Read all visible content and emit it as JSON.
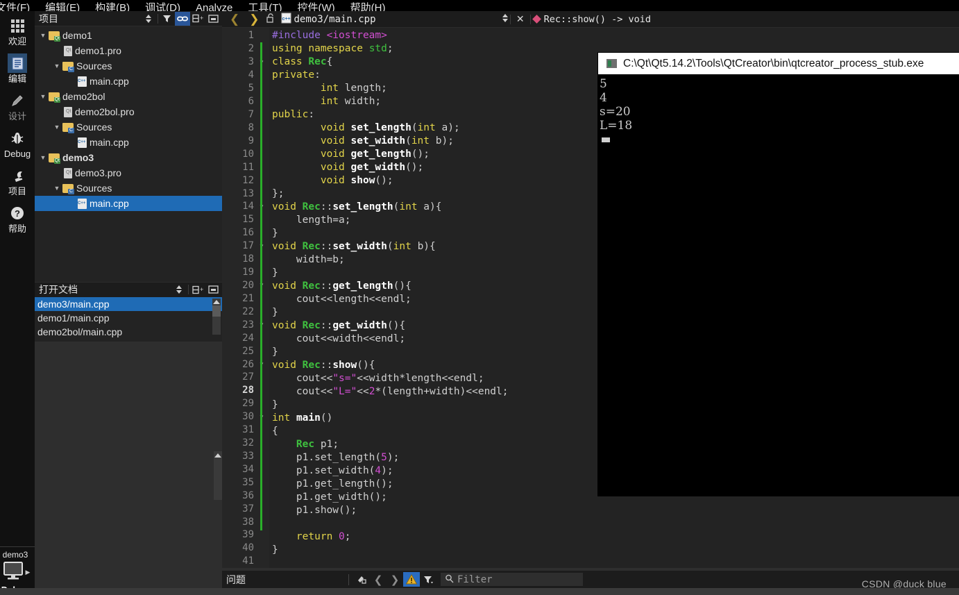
{
  "menubar": {
    "items": [
      {
        "label": "文件(F)"
      },
      {
        "label": "编辑(E)"
      },
      {
        "label": "构建(B)"
      },
      {
        "label": "调试(D)"
      },
      {
        "label": "Analyze"
      },
      {
        "label": "工具(T)"
      },
      {
        "label": "控件(W)"
      },
      {
        "label": "帮助(H)"
      }
    ]
  },
  "modebar": {
    "items": [
      {
        "label": "欢迎",
        "icon": "grid-icon"
      },
      {
        "label": "编辑",
        "icon": "document-icon"
      },
      {
        "label": "设计",
        "icon": "pencil-icon"
      },
      {
        "label": "Debug",
        "icon": "bug-icon"
      },
      {
        "label": "项目",
        "icon": "wrench-icon"
      },
      {
        "label": "帮助",
        "icon": "question-icon"
      }
    ],
    "active": "编辑",
    "run": {
      "kit_name": "demo3",
      "debug_label": "Debug",
      "monitor_icon": "monitor-icon",
      "play_icon": "play-arrow-icon"
    }
  },
  "project_panel": {
    "title": "项目",
    "toolbar": [
      {
        "name": "filter-mode-selector",
        "icon": "updown-arrows-icon"
      },
      {
        "name": "filter-tree-button",
        "icon": "funnel-icon"
      },
      {
        "name": "synchronize-with-editor-button",
        "icon": "link-icon",
        "selected": true
      },
      {
        "name": "split-button",
        "icon": "split-icon"
      },
      {
        "name": "close-sidebar-button",
        "icon": "close-panel-icon"
      }
    ],
    "tree": [
      {
        "label": "demo1",
        "depth": 0,
        "icon": "qt-project-folder-icon",
        "arrow": "expanded",
        "bold": false,
        "selected": false
      },
      {
        "label": "demo1.pro",
        "depth": 1,
        "icon": "pro-file-icon",
        "arrow": "none",
        "bold": false,
        "selected": false
      },
      {
        "label": "Sources",
        "depth": 1,
        "icon": "sources-folder-icon",
        "arrow": "expanded",
        "bold": false,
        "selected": false
      },
      {
        "label": "main.cpp",
        "depth": 2,
        "icon": "cpp-file-icon",
        "arrow": "none",
        "bold": false,
        "selected": false
      },
      {
        "label": "demo2bol",
        "depth": 0,
        "icon": "qt-project-folder-icon",
        "arrow": "expanded",
        "bold": false,
        "selected": false
      },
      {
        "label": "demo2bol.pro",
        "depth": 1,
        "icon": "pro-file-icon",
        "arrow": "none",
        "bold": false,
        "selected": false
      },
      {
        "label": "Sources",
        "depth": 1,
        "icon": "sources-folder-icon",
        "arrow": "expanded",
        "bold": false,
        "selected": false
      },
      {
        "label": "main.cpp",
        "depth": 2,
        "icon": "cpp-file-icon",
        "arrow": "none",
        "bold": false,
        "selected": false
      },
      {
        "label": "demo3",
        "depth": 0,
        "icon": "qt-project-folder-icon",
        "arrow": "expanded",
        "bold": true,
        "selected": false
      },
      {
        "label": "demo3.pro",
        "depth": 1,
        "icon": "pro-file-icon",
        "arrow": "none",
        "bold": false,
        "selected": false
      },
      {
        "label": "Sources",
        "depth": 1,
        "icon": "sources-folder-icon",
        "arrow": "expanded",
        "bold": false,
        "selected": false
      },
      {
        "label": "main.cpp",
        "depth": 2,
        "icon": "cpp-file-icon",
        "arrow": "none",
        "bold": false,
        "selected": true
      }
    ]
  },
  "open_documents": {
    "title": "打开文档",
    "toolbar": [
      {
        "name": "opendocs-sort-button",
        "icon": "updown-arrows-icon"
      },
      {
        "name": "opendocs-split-button",
        "icon": "split-icon"
      },
      {
        "name": "opendocs-close-button",
        "icon": "close-panel-icon"
      }
    ],
    "items": [
      {
        "label": "demo3/main.cpp",
        "selected": true
      },
      {
        "label": "demo1/main.cpp",
        "selected": false
      },
      {
        "label": "demo2bol/main.cpp",
        "selected": false
      }
    ]
  },
  "editor": {
    "toolbar": {
      "back_icon": "chevron-left-icon",
      "forward_icon": "chevron-right-icon",
      "lock_icon": "unlocked-padlock-icon",
      "file_icon": "cpp-file-icon",
      "file_name": "demo3/main.cpp",
      "updown_icon": "updown-arrows-icon",
      "close_icon": "close-icon",
      "symbol_icon": "method-diamond-icon",
      "symbol_name": "Rec::show() -> void"
    },
    "current_line": 28,
    "total_lines": 41,
    "lines": [
      {
        "n": 1,
        "fold": false,
        "mod": false,
        "tokens": [
          [
            "pp",
            "#include"
          ],
          [
            "n",
            " "
          ],
          [
            "inc",
            "<iostream>"
          ]
        ]
      },
      {
        "n": 2,
        "fold": false,
        "mod": true,
        "tokens": [
          [
            "k",
            "using"
          ],
          [
            "n",
            " "
          ],
          [
            "k",
            "namespace"
          ],
          [
            "n",
            " "
          ],
          [
            "gr",
            "std"
          ],
          [
            "n",
            ";"
          ]
        ]
      },
      {
        "n": 3,
        "fold": true,
        "mod": true,
        "tokens": [
          [
            "k",
            "class"
          ],
          [
            "n",
            " "
          ],
          [
            "ty",
            "Rec"
          ],
          [
            "n",
            "{"
          ]
        ]
      },
      {
        "n": 4,
        "fold": false,
        "mod": true,
        "tokens": [
          [
            "k",
            "private"
          ],
          [
            "n",
            ":"
          ]
        ]
      },
      {
        "n": 5,
        "fold": false,
        "mod": true,
        "tokens": [
          [
            "n",
            "        "
          ],
          [
            "k",
            "int"
          ],
          [
            "n",
            " length;"
          ]
        ]
      },
      {
        "n": 6,
        "fold": false,
        "mod": true,
        "tokens": [
          [
            "n",
            "        "
          ],
          [
            "k",
            "int"
          ],
          [
            "n",
            " width;"
          ]
        ]
      },
      {
        "n": 7,
        "fold": false,
        "mod": true,
        "tokens": [
          [
            "k",
            "public"
          ],
          [
            "n",
            ":"
          ]
        ]
      },
      {
        "n": 8,
        "fold": false,
        "mod": true,
        "tokens": [
          [
            "n",
            "        "
          ],
          [
            "k",
            "void"
          ],
          [
            "n",
            " "
          ],
          [
            "fn",
            "set_length"
          ],
          [
            "n",
            "("
          ],
          [
            "k",
            "int"
          ],
          [
            "n",
            " a);"
          ]
        ]
      },
      {
        "n": 9,
        "fold": false,
        "mod": true,
        "tokens": [
          [
            "n",
            "        "
          ],
          [
            "k",
            "void"
          ],
          [
            "n",
            " "
          ],
          [
            "fn",
            "set_width"
          ],
          [
            "n",
            "("
          ],
          [
            "k",
            "int"
          ],
          [
            "n",
            " b);"
          ]
        ]
      },
      {
        "n": 10,
        "fold": false,
        "mod": true,
        "tokens": [
          [
            "n",
            "        "
          ],
          [
            "k",
            "void"
          ],
          [
            "n",
            " "
          ],
          [
            "fn",
            "get_length"
          ],
          [
            "n",
            "();"
          ]
        ]
      },
      {
        "n": 11,
        "fold": false,
        "mod": true,
        "tokens": [
          [
            "n",
            "        "
          ],
          [
            "k",
            "void"
          ],
          [
            "n",
            " "
          ],
          [
            "fn",
            "get_width"
          ],
          [
            "n",
            "();"
          ]
        ]
      },
      {
        "n": 12,
        "fold": false,
        "mod": true,
        "tokens": [
          [
            "n",
            "        "
          ],
          [
            "k",
            "void"
          ],
          [
            "n",
            " "
          ],
          [
            "fn",
            "show"
          ],
          [
            "n",
            "();"
          ]
        ]
      },
      {
        "n": 13,
        "fold": false,
        "mod": true,
        "tokens": [
          [
            "n",
            "};"
          ]
        ]
      },
      {
        "n": 14,
        "fold": true,
        "mod": true,
        "tokens": [
          [
            "k",
            "void"
          ],
          [
            "n",
            " "
          ],
          [
            "ty",
            "Rec"
          ],
          [
            "n",
            "::"
          ],
          [
            "fn",
            "set_length"
          ],
          [
            "n",
            "("
          ],
          [
            "k",
            "int"
          ],
          [
            "n",
            " a){"
          ]
        ]
      },
      {
        "n": 15,
        "fold": false,
        "mod": true,
        "tokens": [
          [
            "n",
            "    length=a;"
          ]
        ]
      },
      {
        "n": 16,
        "fold": false,
        "mod": true,
        "tokens": [
          [
            "n",
            "}"
          ]
        ]
      },
      {
        "n": 17,
        "fold": true,
        "mod": true,
        "tokens": [
          [
            "k",
            "void"
          ],
          [
            "n",
            " "
          ],
          [
            "ty",
            "Rec"
          ],
          [
            "n",
            "::"
          ],
          [
            "fn",
            "set_width"
          ],
          [
            "n",
            "("
          ],
          [
            "k",
            "int"
          ],
          [
            "n",
            " b){"
          ]
        ]
      },
      {
        "n": 18,
        "fold": false,
        "mod": true,
        "tokens": [
          [
            "n",
            "    width=b;"
          ]
        ]
      },
      {
        "n": 19,
        "fold": false,
        "mod": true,
        "tokens": [
          [
            "n",
            "}"
          ]
        ]
      },
      {
        "n": 20,
        "fold": true,
        "mod": true,
        "tokens": [
          [
            "k",
            "void"
          ],
          [
            "n",
            " "
          ],
          [
            "ty",
            "Rec"
          ],
          [
            "n",
            "::"
          ],
          [
            "fn",
            "get_length"
          ],
          [
            "n",
            "(){"
          ]
        ]
      },
      {
        "n": 21,
        "fold": false,
        "mod": true,
        "tokens": [
          [
            "n",
            "    cout<<length<<endl;"
          ]
        ]
      },
      {
        "n": 22,
        "fold": false,
        "mod": true,
        "tokens": [
          [
            "n",
            "}"
          ]
        ]
      },
      {
        "n": 23,
        "fold": true,
        "mod": true,
        "tokens": [
          [
            "k",
            "void"
          ],
          [
            "n",
            " "
          ],
          [
            "ty",
            "Rec"
          ],
          [
            "n",
            "::"
          ],
          [
            "fn",
            "get_width"
          ],
          [
            "n",
            "(){"
          ]
        ]
      },
      {
        "n": 24,
        "fold": false,
        "mod": true,
        "tokens": [
          [
            "n",
            "    cout<<width<<endl;"
          ]
        ]
      },
      {
        "n": 25,
        "fold": false,
        "mod": true,
        "tokens": [
          [
            "n",
            "}"
          ]
        ]
      },
      {
        "n": 26,
        "fold": true,
        "mod": true,
        "tokens": [
          [
            "k",
            "void"
          ],
          [
            "n",
            " "
          ],
          [
            "ty",
            "Rec"
          ],
          [
            "n",
            "::"
          ],
          [
            "fn",
            "show"
          ],
          [
            "n",
            "(){"
          ]
        ]
      },
      {
        "n": 27,
        "fold": false,
        "mod": true,
        "tokens": [
          [
            "n",
            "    cout<<"
          ],
          [
            "st",
            "\"s=\""
          ],
          [
            "n",
            "<<width*length<<endl;"
          ]
        ]
      },
      {
        "n": 28,
        "fold": false,
        "mod": true,
        "tokens": [
          [
            "n",
            "    cout<<"
          ],
          [
            "st",
            "\"L=\""
          ],
          [
            "n",
            "<<"
          ],
          [
            "nu",
            "2"
          ],
          [
            "n",
            "*(length+width)<<endl;"
          ]
        ]
      },
      {
        "n": 29,
        "fold": false,
        "mod": true,
        "tokens": [
          [
            "n",
            "}"
          ]
        ]
      },
      {
        "n": 30,
        "fold": true,
        "mod": false,
        "tokens": [
          [
            "k",
            "int"
          ],
          [
            "n",
            " "
          ],
          [
            "fn",
            "main"
          ],
          [
            "n",
            "()"
          ]
        ]
      },
      {
        "n": 31,
        "fold": false,
        "mod": false,
        "tokens": [
          [
            "n",
            "{"
          ]
        ]
      },
      {
        "n": 32,
        "fold": false,
        "mod": true,
        "tokens": [
          [
            "n",
            "    "
          ],
          [
            "ty",
            "Rec"
          ],
          [
            "n",
            " p1;"
          ]
        ]
      },
      {
        "n": 33,
        "fold": false,
        "mod": true,
        "tokens": [
          [
            "n",
            "    p1.set_length("
          ],
          [
            "nu",
            "5"
          ],
          [
            "n",
            ");"
          ]
        ]
      },
      {
        "n": 34,
        "fold": false,
        "mod": true,
        "tokens": [
          [
            "n",
            "    p1.set_width("
          ],
          [
            "nu",
            "4"
          ],
          [
            "n",
            ");"
          ]
        ]
      },
      {
        "n": 35,
        "fold": false,
        "mod": true,
        "tokens": [
          [
            "n",
            "    p1.get_length();"
          ]
        ]
      },
      {
        "n": 36,
        "fold": false,
        "mod": true,
        "tokens": [
          [
            "n",
            "    p1.get_width();"
          ]
        ]
      },
      {
        "n": 37,
        "fold": false,
        "mod": true,
        "tokens": [
          [
            "n",
            "    p1.show();"
          ]
        ]
      },
      {
        "n": 38,
        "fold": false,
        "mod": true,
        "tokens": [
          [
            "n",
            ""
          ]
        ]
      },
      {
        "n": 39,
        "fold": false,
        "mod": false,
        "tokens": [
          [
            "n",
            "    "
          ],
          [
            "k",
            "return"
          ],
          [
            "n",
            " "
          ],
          [
            "nu",
            "0"
          ],
          [
            "n",
            ";"
          ]
        ]
      },
      {
        "n": 40,
        "fold": false,
        "mod": false,
        "tokens": [
          [
            "n",
            "}"
          ]
        ]
      },
      {
        "n": 41,
        "fold": false,
        "mod": false,
        "tokens": [
          [
            "n",
            ""
          ]
        ]
      }
    ]
  },
  "console": {
    "title": "C:\\Qt\\Qt5.14.2\\Tools\\QtCreator\\bin\\qtcreator_process_stub.exe",
    "icon": "console-window-icon",
    "output": [
      "5",
      "4",
      "s=20",
      "L=18"
    ]
  },
  "bottom_bar": {
    "title": "问题",
    "buttons": [
      {
        "name": "clear-issues-button",
        "icon": "broom-icon"
      },
      {
        "name": "previous-issue-button",
        "icon": "chevron-left-icon"
      },
      {
        "name": "next-issue-button",
        "icon": "chevron-right-icon"
      },
      {
        "name": "warnings-filter-button",
        "icon": "warning-triangle-icon",
        "active": true
      },
      {
        "name": "filter-dropdown-button",
        "icon": "funnel-icon"
      }
    ],
    "filter_placeholder": "Filter",
    "filter_icon": "search-icon"
  },
  "watermark": "CSDN @duck blue",
  "colors": {
    "selection_blue": "#1f6bb5",
    "accent_blue": "#2a5699",
    "modified_green": "#2ab02a",
    "keyword_yellow": "#e2d44a",
    "type_green": "#3fc13f",
    "string_magenta": "#d24fd2",
    "preprocessor_purple": "#9a6ee0"
  }
}
